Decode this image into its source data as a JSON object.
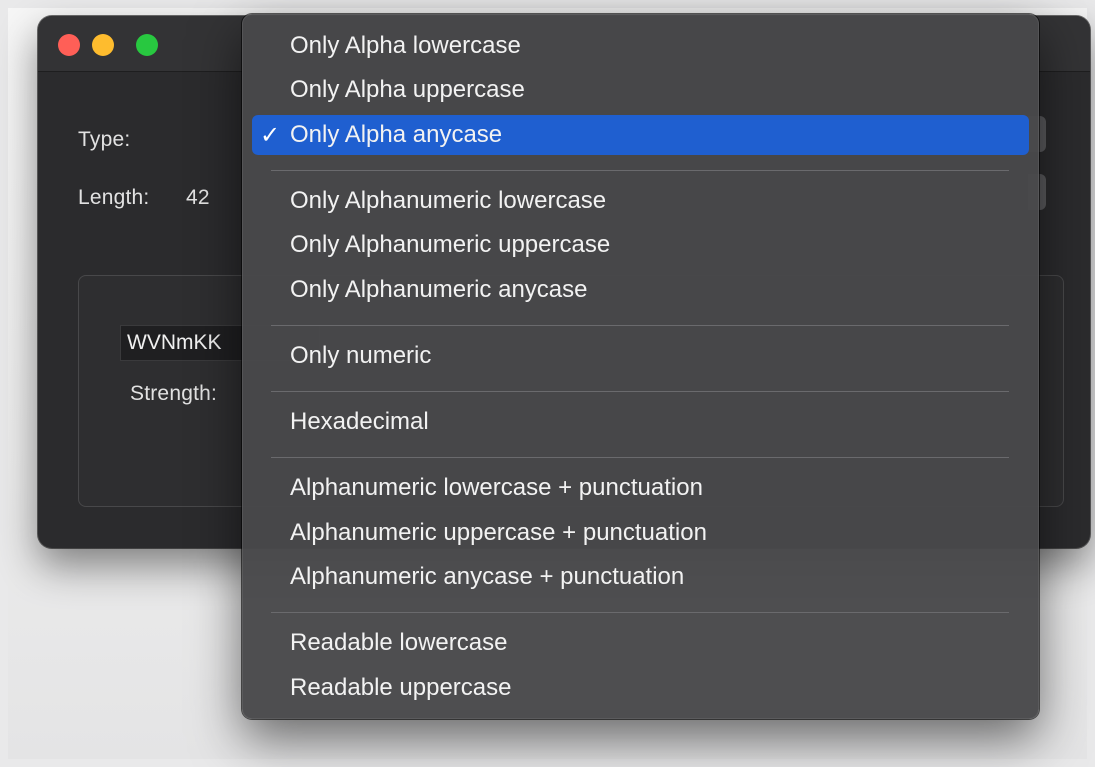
{
  "window": {
    "type_label": "Type:",
    "length_label": "Length:",
    "length_value": "42",
    "password_value": "WVNmKK",
    "strength_label": "Strength:"
  },
  "menu": {
    "selected_index": 2,
    "check_glyph": "✓",
    "accent_color": "#1f5fd0",
    "groups": [
      [
        "Only Alpha lowercase",
        "Only Alpha uppercase",
        "Only Alpha anycase"
      ],
      [
        "Only Alphanumeric lowercase",
        "Only Alphanumeric uppercase",
        "Only Alphanumeric anycase"
      ],
      [
        "Only numeric"
      ],
      [
        "Hexadecimal"
      ],
      [
        "Alphanumeric lowercase + punctuation",
        "Alphanumeric uppercase + punctuation",
        "Alphanumeric anycase + punctuation"
      ],
      [
        "Readable lowercase",
        "Readable uppercase"
      ]
    ]
  }
}
